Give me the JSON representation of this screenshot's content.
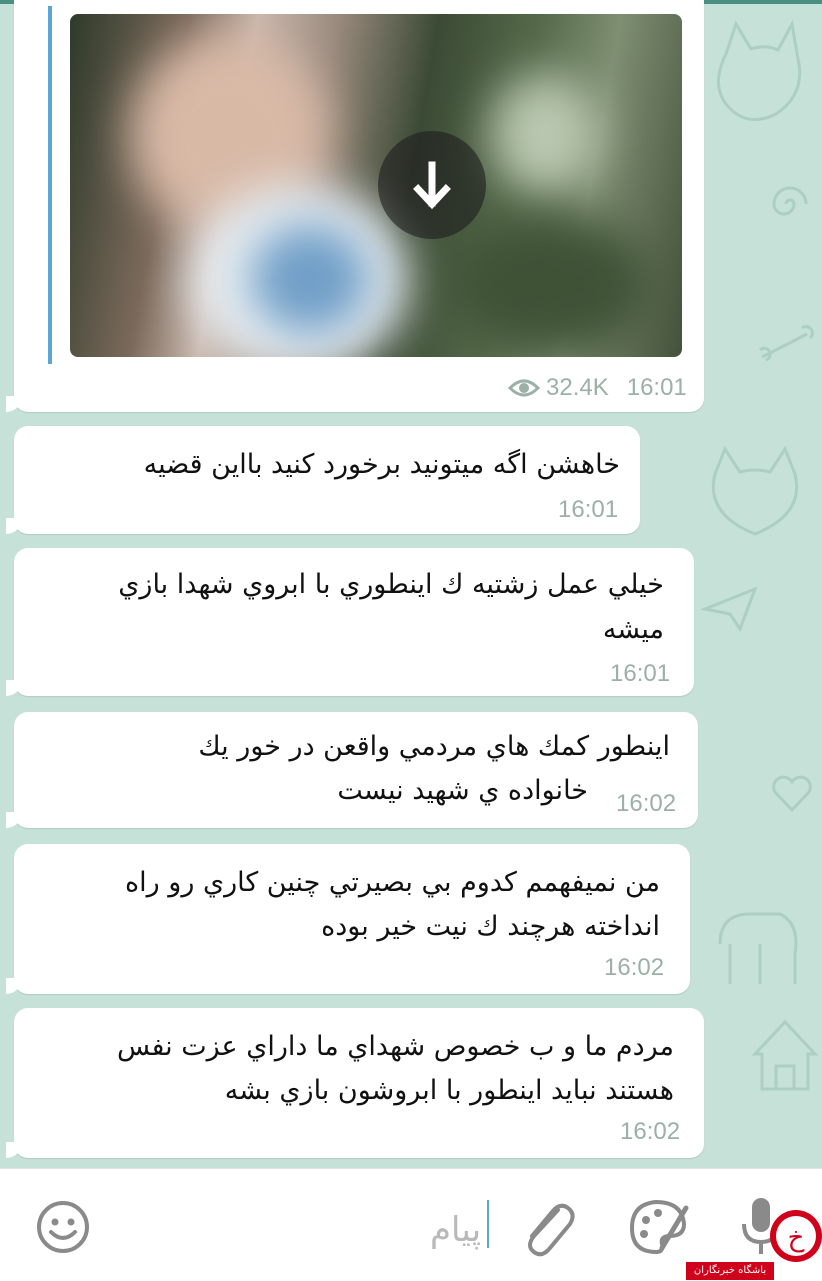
{
  "media_message": {
    "views": "32.4K",
    "time": "16:01"
  },
  "messages": [
    {
      "lines": [
        "خاهشن اگه میتونید برخورد کنید بااین قضیه"
      ],
      "time": "16:01"
    },
    {
      "lines": [
        "خيلي عمل زشتيه ك اينطوري با ابروي شهدا بازي",
        "ميشه"
      ],
      "time": "16:01"
    },
    {
      "lines": [
        "اينطور كمك هاي مردمي واقعن در خور يك",
        "خانواده ي شهيد نيست"
      ],
      "time": "16:02"
    },
    {
      "lines": [
        "من نميفهمم كدوم بي بصيرتي چنين كاري رو راه",
        "انداخته هرچند ك نيت خير بوده"
      ],
      "time": "16:02"
    },
    {
      "lines": [
        "مردم ما و ب خصوص شهداي ما داراي عزت نفس",
        "هستند نبايد اينطور با ابروشون بازي بشه"
      ],
      "time": "16:02"
    }
  ],
  "input": {
    "placeholder": "پیام"
  },
  "icons": {
    "emoji": "emoji-icon",
    "attach": "paperclip-icon",
    "sticker": "palette-icon",
    "mic": "microphone-icon",
    "download": "download-arrow-icon",
    "views": "eye-icon"
  },
  "colors": {
    "chat_background": "#c6e1d7",
    "bubble": "#ffffff",
    "time_text": "#9bb0a7",
    "quote_bar": "#5aa6d6",
    "top_bar": "#4a8f82"
  },
  "watermark": {
    "label": "باشگاه خبرنگاران",
    "logo_glyph": "خ"
  }
}
